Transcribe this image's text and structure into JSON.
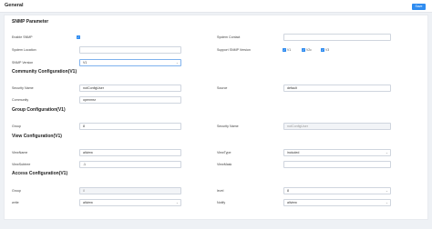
{
  "header": {
    "title": "General",
    "save_label": "Save"
  },
  "snmp": {
    "section_title": "SNMP Parameter",
    "enable_label": "Enable SNMP",
    "system_contact_label": "System Contact",
    "system_contact_value": "",
    "system_location_label": "System Location",
    "system_location_value": "",
    "support_version_label": "Support SNMP Version",
    "versions": [
      "V1",
      "V2c",
      "V3"
    ],
    "snmp_version_label": "SNMP Version",
    "snmp_version_value": "V1"
  },
  "community": {
    "section_title": "Community Configuration(V1)",
    "security_name_label": "Security Name",
    "security_name_value": "notConfigUser",
    "source_label": "Source",
    "source_value": "default",
    "community_label": "Community",
    "community_value": "openmsr"
  },
  "group": {
    "section_title": "Group Configuration(V1)",
    "group_label": "Group",
    "group_value": "8",
    "security_name_label": "Security Name",
    "security_name_value": "notConfigUser"
  },
  "view": {
    "section_title": "View Configuration(V1)",
    "viewname_label": "ViewName",
    "viewname_value": "allview",
    "viewtype_label": "ViewType",
    "viewtype_value": "included",
    "viewsubtree_label": "ViewSubtree",
    "viewsubtree_value": ".1",
    "viewmask_label": "ViewMask",
    "viewmask_value": ""
  },
  "access": {
    "section_title": "Access Configuration(V1)",
    "group_label": "Group",
    "group_value": "8",
    "level_label": "level",
    "level_value": "8",
    "write_label": "write",
    "write_value": "allview",
    "notify_label": "Notify",
    "notify_value": "allview"
  },
  "colors": {
    "accent": "#2f8cf0",
    "background": "#eef1f5"
  }
}
